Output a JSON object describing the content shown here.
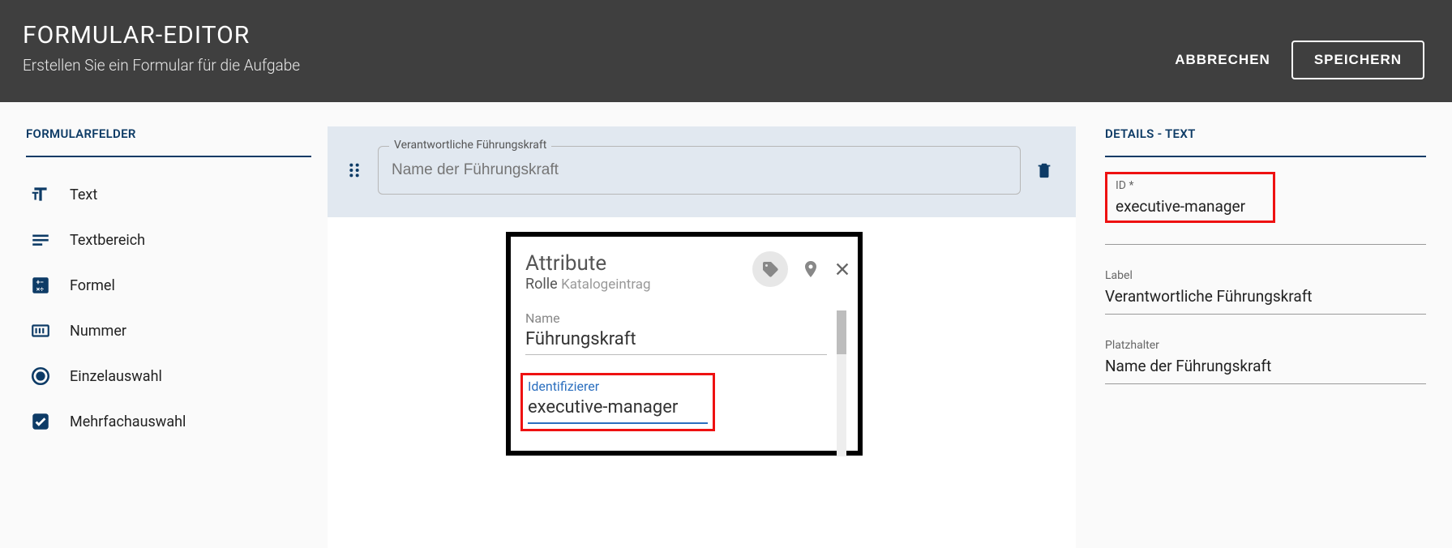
{
  "header": {
    "title": "FORMULAR-EDITOR",
    "subtitle": "Erstellen Sie ein Formular für die Aufgabe",
    "cancel_label": "ABBRECHEN",
    "save_label": "SPEICHERN"
  },
  "sidebar": {
    "title": "FORMULARFELDER",
    "items": [
      {
        "label": "Text"
      },
      {
        "label": "Textbereich"
      },
      {
        "label": "Formel"
      },
      {
        "label": "Nummer"
      },
      {
        "label": "Einzelauswahl"
      },
      {
        "label": "Mehrfachauswahl"
      }
    ]
  },
  "canvas": {
    "field": {
      "label": "Verantwortliche Führungskraft",
      "placeholder": "Name der Führungskraft"
    }
  },
  "popup": {
    "title": "Attribute",
    "subtitle_strong": "Rolle",
    "subtitle_light": "Katalogeintrag",
    "name_label": "Name",
    "name_value": "Führungskraft",
    "id_label": "Identifizierer",
    "id_value": "executive-manager"
  },
  "details": {
    "title": "DETAILS - TEXT",
    "id_label": "ID *",
    "id_value": "executive-manager",
    "label_label": "Label",
    "label_value": "Verantwortliche Führungskraft",
    "placeholder_label": "Platzhalter",
    "placeholder_value": "Name der Führungskraft"
  }
}
